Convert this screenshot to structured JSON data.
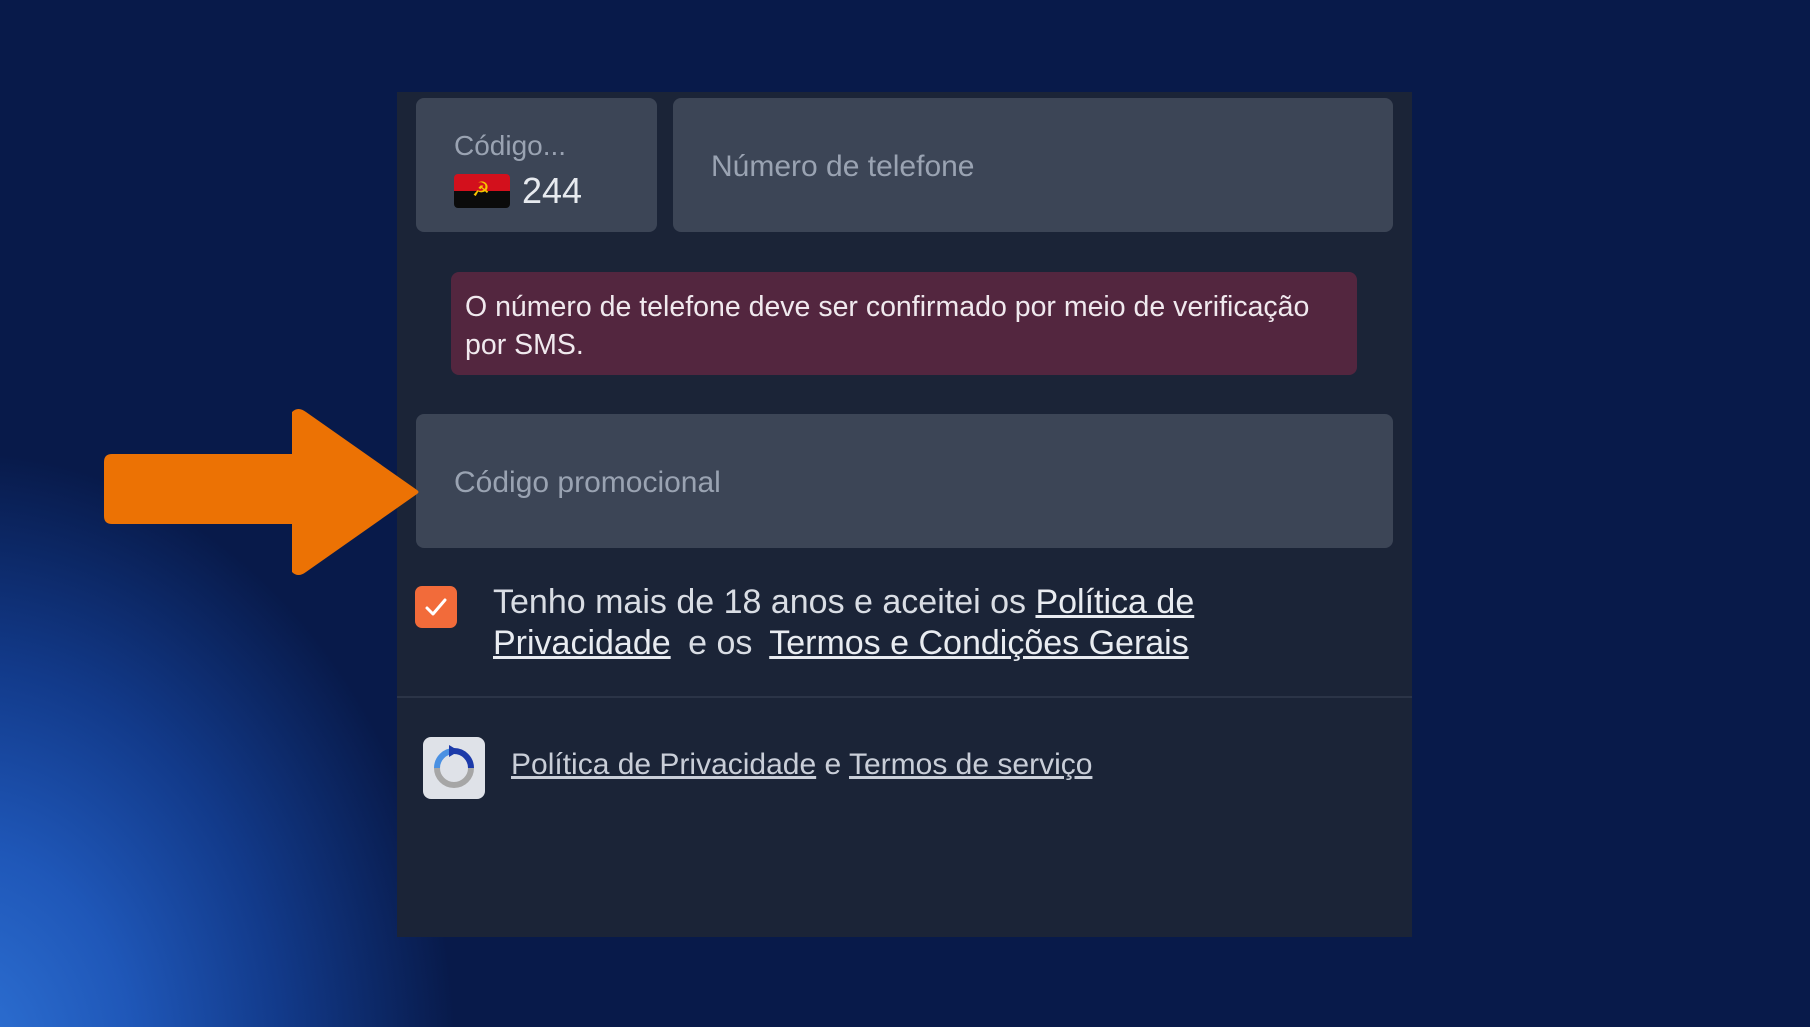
{
  "form": {
    "country_code": {
      "label": "Código...",
      "flag_icon": "angola-flag-icon",
      "value": "244"
    },
    "phone": {
      "placeholder": "Número de telefone"
    },
    "notice": "O número de telefone deve ser confirmado por meio de verificação por SMS.",
    "promo": {
      "placeholder": "Código promocional"
    },
    "consent": {
      "checked": true,
      "text_before": "Tenho mais de 18 anos e aceitei os",
      "privacy_link": "Política de Privacidade",
      "text_middle": "e os",
      "terms_link": "Termos e Condições Gerais"
    },
    "recaptcha": {
      "icon": "recaptcha-icon",
      "privacy_link": "Política de Privacidade",
      "separator": "e",
      "terms_link": "Termos de serviço"
    }
  },
  "annotation": {
    "icon": "arrow-right-icon",
    "color": "#ec7204"
  },
  "colors": {
    "panel_bg": "#1b2437",
    "field_bg": "#3c4556",
    "notice_bg": "#53263f",
    "checkbox": "#f26b3a"
  }
}
